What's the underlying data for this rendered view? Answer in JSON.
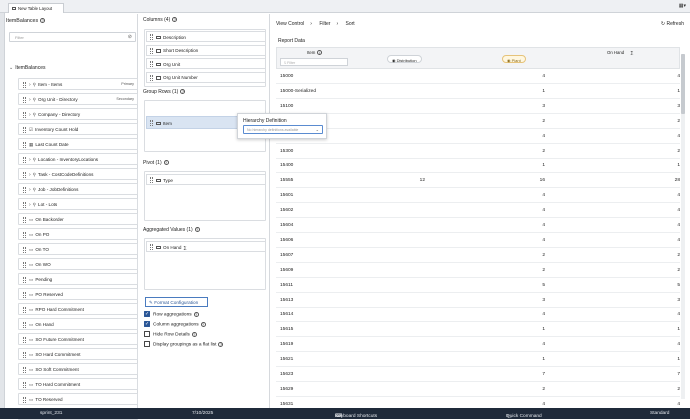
{
  "tab": {
    "title": "New Table Layout"
  },
  "left_panel": {
    "title": "ItemBalances",
    "filter_placeholder": "Filter",
    "root_label": "ItemBalances",
    "items": [
      {
        "label": "Item - Items",
        "expandable": true,
        "search": true,
        "badge": "Primary"
      },
      {
        "label": "Org Unit - Directory",
        "expandable": true,
        "search": true,
        "badge": "Secondary"
      },
      {
        "label": "Company - Directory",
        "expandable": true,
        "search": true,
        "badge": ""
      },
      {
        "label": "Inventory Count Hold",
        "expandable": false,
        "icon": "check",
        "badge": ""
      },
      {
        "label": "Last Count Date",
        "expandable": false,
        "icon": "calendar",
        "badge": ""
      },
      {
        "label": "Location - InventoryLocations",
        "expandable": true,
        "search": true,
        "badge": ""
      },
      {
        "label": "Task - CostCodeDefinitions",
        "expandable": true,
        "search": true,
        "badge": ""
      },
      {
        "label": "Job - JobDefinitions",
        "expandable": true,
        "search": true,
        "badge": ""
      },
      {
        "label": "Lot - Lots",
        "expandable": true,
        "search": true,
        "badge": ""
      },
      {
        "label": "On Backorder",
        "expandable": false,
        "badge": ""
      },
      {
        "label": "On PO",
        "expandable": false,
        "badge": ""
      },
      {
        "label": "On TO",
        "expandable": false,
        "badge": ""
      },
      {
        "label": "On WO",
        "expandable": false,
        "badge": ""
      },
      {
        "label": "Pending",
        "expandable": false,
        "badge": ""
      },
      {
        "label": "PO Reserved",
        "expandable": false,
        "badge": ""
      },
      {
        "label": "RPO Hard Commitment",
        "expandable": false,
        "badge": ""
      },
      {
        "label": "On Hand",
        "expandable": false,
        "badge": ""
      },
      {
        "label": "SO Future Commitment",
        "expandable": false,
        "badge": ""
      },
      {
        "label": "SO Hard Commitment",
        "expandable": false,
        "badge": ""
      },
      {
        "label": "SO Soft Commitment",
        "expandable": false,
        "badge": ""
      },
      {
        "label": "TO Hard Commitment",
        "expandable": false,
        "badge": ""
      },
      {
        "label": "TO Reserved",
        "expandable": false,
        "badge": ""
      },
      {
        "label": "TO Soft Commitment",
        "expandable": false,
        "badge": ""
      }
    ]
  },
  "middle_panel": {
    "columns_label": "Columns (4)",
    "columns": [
      "Description",
      "Short Description",
      "Org Unit",
      "Org Unit Number"
    ],
    "group_rows_label": "Group Rows (1)",
    "group_rows": [
      "Item"
    ],
    "pivot_label": "Pivot (1)",
    "pivot": [
      "Type"
    ],
    "aggregated_label": "Aggregated Values (1)",
    "aggregated": [
      "On Hand"
    ],
    "format_button": "Format Configuration",
    "options": [
      {
        "label": "Row aggregations",
        "checked": true,
        "help": true
      },
      {
        "label": "Column aggregations",
        "checked": true,
        "help": true
      },
      {
        "label": "Hide Row Details",
        "checked": false,
        "help": true
      },
      {
        "label": "Display groupings as a flat list",
        "checked": false,
        "help": true
      }
    ]
  },
  "popup": {
    "title": "Hierarchy Definition",
    "placeholder": "No hierarchy definitions available"
  },
  "right_panel": {
    "breadcrumb": [
      "View Control",
      "Filter",
      "Sort"
    ],
    "refresh_label": "Refresh",
    "section_title": "Report Data",
    "headers": {
      "item": "Item",
      "distribution": "Distribution",
      "plant": "Plant",
      "on_hand": "On Hand"
    },
    "filter_placeholder": "Filter",
    "rows": [
      [
        "15000",
        "",
        "4",
        "4"
      ],
      [
        "15000-Serialized",
        "",
        "1",
        "1"
      ],
      [
        "15100",
        "",
        "3",
        "3"
      ],
      [
        "15200",
        "",
        "2",
        "2"
      ],
      [
        "15250",
        "",
        "4",
        "4"
      ],
      [
        "15300",
        "",
        "2",
        "2"
      ],
      [
        "15400",
        "",
        "1",
        "1"
      ],
      [
        "15555",
        "12",
        "16",
        "28"
      ],
      [
        "15601",
        "",
        "4",
        "4"
      ],
      [
        "15602",
        "",
        "4",
        "4"
      ],
      [
        "15604",
        "",
        "4",
        "4"
      ],
      [
        "15606",
        "",
        "4",
        "4"
      ],
      [
        "15607",
        "",
        "2",
        "2"
      ],
      [
        "15609",
        "",
        "2",
        "2"
      ],
      [
        "15611",
        "",
        "5",
        "5"
      ],
      [
        "15613",
        "",
        "3",
        "3"
      ],
      [
        "15614",
        "",
        "4",
        "4"
      ],
      [
        "15615",
        "",
        "1",
        "1"
      ],
      [
        "15619",
        "",
        "4",
        "4"
      ],
      [
        "15621",
        "",
        "1",
        "1"
      ],
      [
        "15623",
        "",
        "7",
        "7"
      ],
      [
        "15629",
        "",
        "2",
        "2"
      ],
      [
        "15631",
        "",
        "4",
        "4"
      ]
    ]
  },
  "status_bar": {
    "env": "sprint_231",
    "date": "7/10/2025",
    "shortcuts": "Keyboard Shortcuts",
    "quick": "Quick Command",
    "mode": "Standard"
  }
}
